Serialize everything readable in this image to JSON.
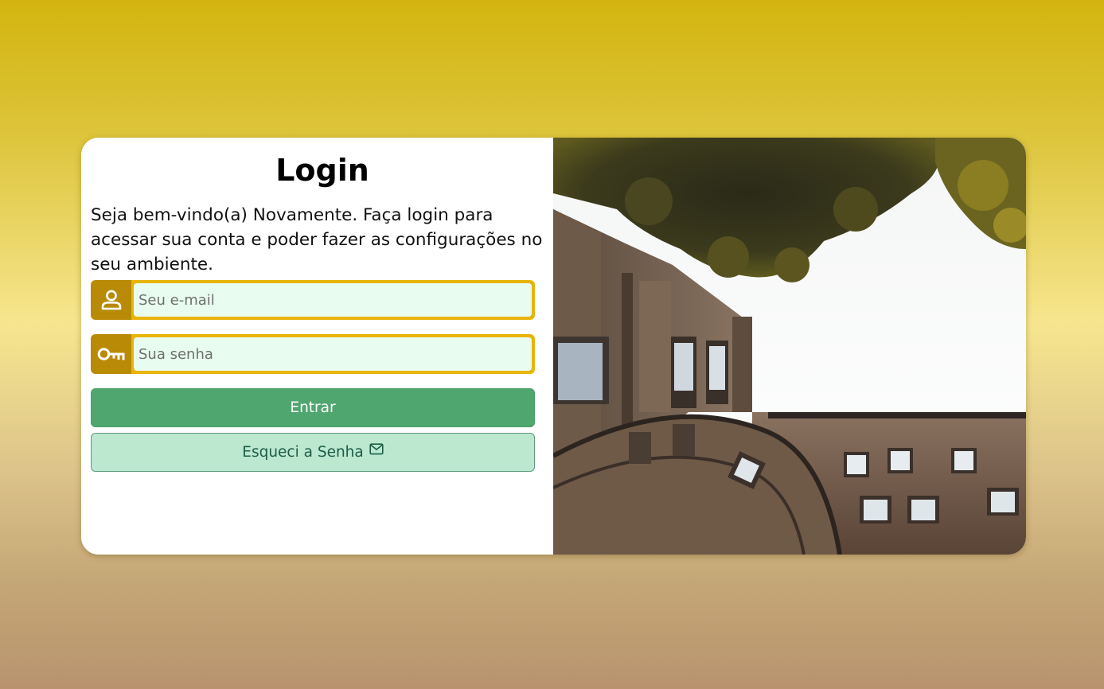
{
  "login": {
    "title": "Login",
    "welcome_text": "Seja bem-vindo(a) Novamente. Faça login para acessar sua conta e poder fazer as configurações no seu ambiente.",
    "email_field": {
      "placeholder": "Seu e-mail",
      "value": "",
      "icon": "user-icon"
    },
    "password_field": {
      "placeholder": "Sua senha",
      "value": "",
      "icon": "key-icon"
    },
    "submit_label": "Entrar",
    "forgot_label": "Esqueci a Senha",
    "forgot_icon": "envelope-icon"
  },
  "hero_image": {
    "subject": "building-and-tree-photo"
  },
  "colors": {
    "icon_box": "#b98a05",
    "input_border": "#e8b40a",
    "input_bg": "#e8fcef",
    "primary_button": "#4fa66f",
    "secondary_button": "#bbe8cf",
    "secondary_text": "#1f5c48"
  }
}
